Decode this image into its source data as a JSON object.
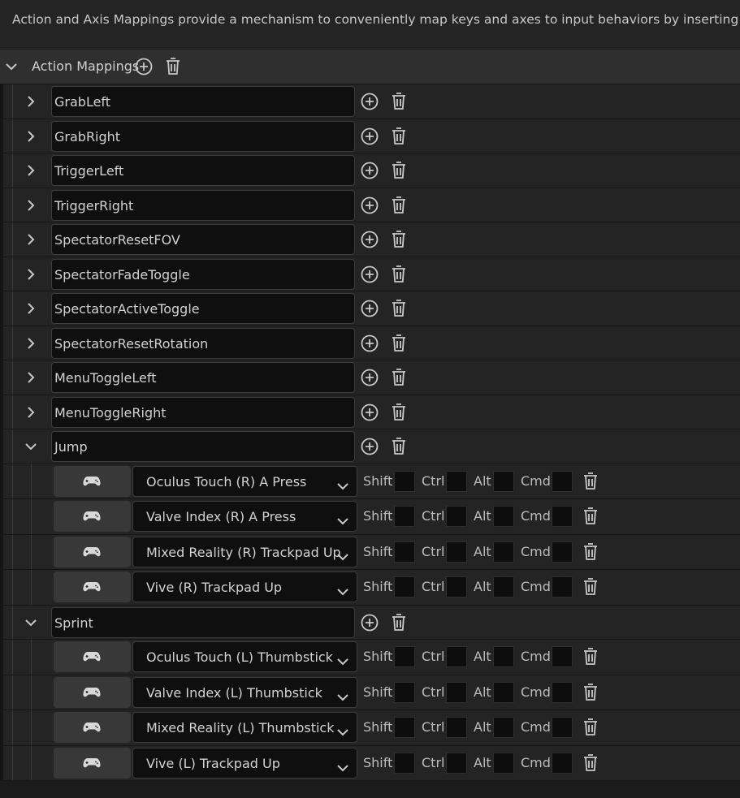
{
  "description": "Action and Axis Mappings provide a mechanism to conveniently map keys and axes to input behaviors by inserting a layer of in",
  "section": {
    "title": "Action Mappings",
    "chevron_icon": "chevron-down-icon",
    "add_icon": "add-circle-icon",
    "delete_icon": "trash-icon"
  },
  "mods": {
    "shift": "Shift",
    "ctrl": "Ctrl",
    "alt": "Alt",
    "cmd": "Cmd"
  },
  "actions": [
    {
      "name": "GrabLeft",
      "expanded": false
    },
    {
      "name": "GrabRight",
      "expanded": false
    },
    {
      "name": "TriggerLeft",
      "expanded": false
    },
    {
      "name": "TriggerRight",
      "expanded": false
    },
    {
      "name": "SpectatorResetFOV",
      "expanded": false
    },
    {
      "name": "SpectatorFadeToggle",
      "expanded": false
    },
    {
      "name": "SpectatorActiveToggle",
      "expanded": false
    },
    {
      "name": "SpectatorResetRotation",
      "expanded": false
    },
    {
      "name": "MenuToggleLeft",
      "expanded": false
    },
    {
      "name": "MenuToggleRight",
      "expanded": false
    },
    {
      "name": "Jump",
      "expanded": true,
      "keys": [
        {
          "key": "Oculus Touch (R) A Press"
        },
        {
          "key": "Valve Index (R) A Press"
        },
        {
          "key": "Mixed Reality (R) Trackpad Up"
        },
        {
          "key": "Vive (R) Trackpad Up"
        }
      ]
    },
    {
      "name": "Sprint",
      "expanded": true,
      "keys": [
        {
          "key": "Oculus Touch (L) Thumbstick"
        },
        {
          "key": "Valve Index (L) Thumbstick"
        },
        {
          "key": "Mixed Reality (L) Thumbstick"
        },
        {
          "key": "Vive (L) Trackpad Up"
        }
      ]
    }
  ]
}
